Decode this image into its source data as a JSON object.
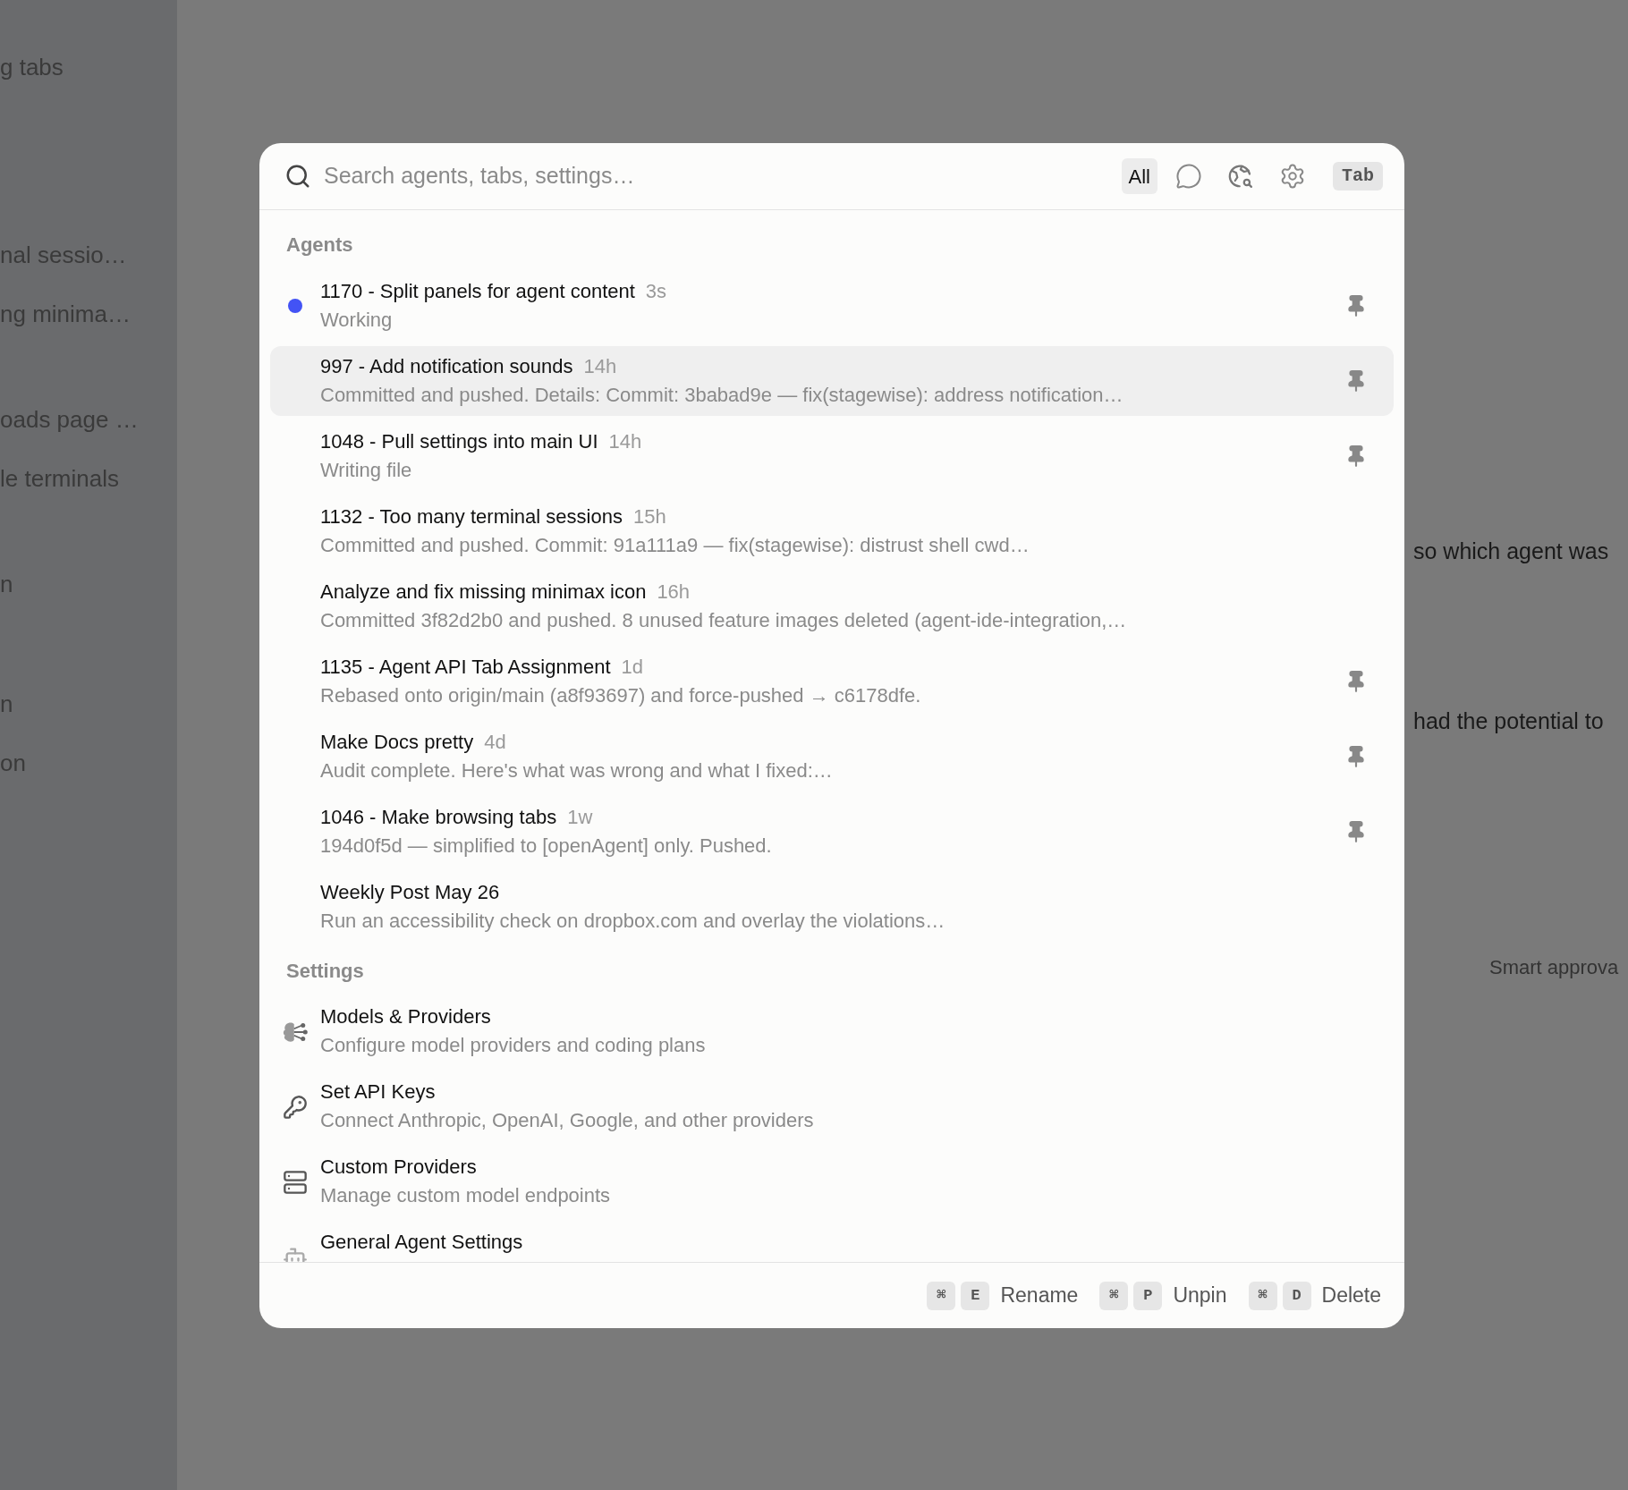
{
  "background": {
    "sidebar_items": [
      "g tabs",
      "nal sessio…",
      "ng minima…",
      "oads page …",
      "le terminals",
      "n",
      "n",
      "on"
    ],
    "content_lines": [
      "so which agent was",
      "had the potential to"
    ],
    "content_label": "Smart approva"
  },
  "palette": {
    "search": {
      "placeholder": "Search agents, tabs, settings…"
    },
    "filters": [
      {
        "kind": "text",
        "label": "All",
        "selected": true
      },
      {
        "kind": "chat",
        "selected": false
      },
      {
        "kind": "web",
        "selected": false
      },
      {
        "kind": "settings",
        "selected": false
      }
    ],
    "tab_key": "Tab",
    "sections": [
      {
        "title": "Agents",
        "items": [
          {
            "title": "1170 - Split panels for agent content",
            "age": "3s",
            "subtitle": "Working",
            "working": true,
            "pinned": true,
            "selected": false
          },
          {
            "title": "997 - Add notification sounds",
            "age": "14h",
            "subtitle": "Committed and pushed. Details: Commit: 3babad9e — fix(stagewise): address notification…",
            "working": false,
            "pinned": true,
            "selected": true
          },
          {
            "title": "1048 - Pull settings into main UI",
            "age": "14h",
            "subtitle": "Writing file",
            "working": false,
            "pinned": true,
            "selected": false
          },
          {
            "title": "1132 - Too many terminal sessions",
            "age": "15h",
            "subtitle": "Committed and pushed. Commit: 91a111a9 — fix(stagewise): distrust shell cwd…",
            "working": false,
            "pinned": false,
            "selected": false
          },
          {
            "title": "Analyze and fix missing minimax icon",
            "age": "16h",
            "subtitle": "Committed 3f82d2b0 and pushed. 8 unused feature images deleted (agent-ide-integration,…",
            "working": false,
            "pinned": false,
            "selected": false
          },
          {
            "title": "1135 - Agent API Tab Assignment",
            "age": "1d",
            "subtitle": "Rebased onto origin/main (a8f93697) and force-pushed → c6178dfe.",
            "working": false,
            "pinned": true,
            "selected": false
          },
          {
            "title": "Make Docs pretty",
            "age": "4d",
            "subtitle": "Audit complete. Here's what was wrong and what I fixed:…",
            "working": false,
            "pinned": true,
            "selected": false
          },
          {
            "title": "1046 - Make browsing tabs",
            "age": "1w",
            "subtitle": "194d0f5d — simplified to [openAgent] only. Pushed.",
            "working": false,
            "pinned": true,
            "selected": false
          },
          {
            "title": "Weekly Post May 26",
            "subtitle": "Run an accessibility check on dropbox.com and overlay the violations…",
            "working": false,
            "pinned": false,
            "selected": false
          }
        ]
      },
      {
        "title": "Settings",
        "items": [
          {
            "kind": "models",
            "title": "Models & Providers",
            "subtitle": "Configure model providers and coding plans"
          },
          {
            "kind": "key",
            "title": "Set API Keys",
            "subtitle": "Connect Anthropic, OpenAI, Google, and other providers"
          },
          {
            "kind": "server",
            "title": "Custom Providers",
            "subtitle": "Manage custom model endpoints"
          },
          {
            "kind": "agent",
            "title": "General Agent Settings"
          }
        ]
      }
    ],
    "shortcuts": [
      {
        "keys": [
          "⌘",
          "E"
        ],
        "label": "Rename"
      },
      {
        "keys": [
          "⌘",
          "P"
        ],
        "label": "Unpin"
      },
      {
        "keys": [
          "⌘",
          "D"
        ],
        "label": "Delete"
      }
    ]
  }
}
